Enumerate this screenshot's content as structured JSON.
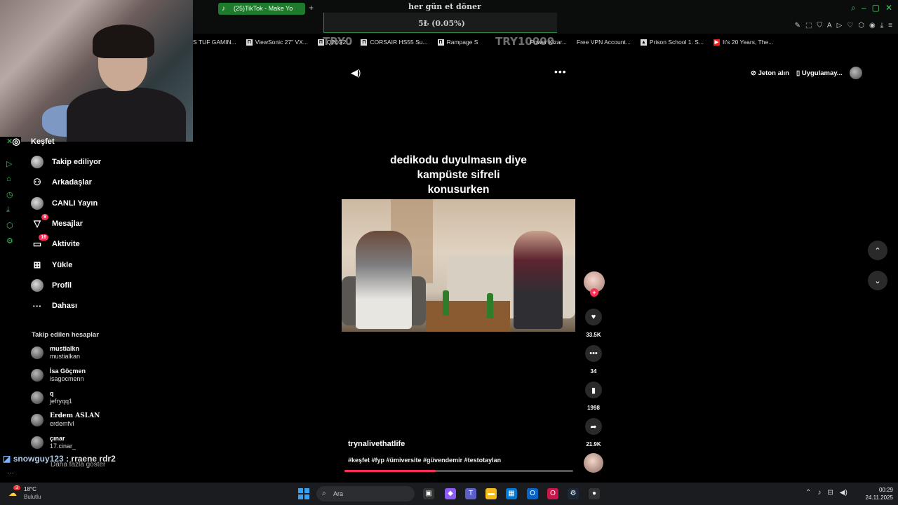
{
  "browser": {
    "tab_label": "(25)TikTok - Make Yo",
    "bookmarks": [
      "S TUF GAMIN...",
      "ViewSonic 27\" VX...",
      "Q24G2...",
      "CORSAIR HS55 Su...",
      "Rampage S",
      "Power Kizar...",
      "Free VPN Account...",
      "Prison School 1. S...",
      "It's 20 Years, The..."
    ]
  },
  "stream_overlay": {
    "title": "her gün et döner",
    "value": "5₺ (0.05%)",
    "left_amount": "TRY0",
    "right_amount": "TRY10000"
  },
  "sidebar": {
    "items": [
      {
        "label": "Keşfet",
        "icon": "compass-icon"
      },
      {
        "label": "Takip ediliyor",
        "icon": "avatar"
      },
      {
        "label": "Arkadaşlar",
        "icon": "friends-icon"
      },
      {
        "label": "CANLI Yayın",
        "icon": "live-icon"
      },
      {
        "label": "Mesajlar",
        "icon": "messages-icon",
        "badge": "9"
      },
      {
        "label": "Aktivite",
        "icon": "activity-icon",
        "badge": "16"
      },
      {
        "label": "Yükle",
        "icon": "upload-icon"
      },
      {
        "label": "Profil",
        "icon": "profile-avatar"
      },
      {
        "label": "Dahası",
        "icon": "more-icon"
      }
    ],
    "following_title": "Takip edilen hesaplar",
    "accounts": [
      {
        "name": "mustialkn",
        "user": "mustialkan"
      },
      {
        "name": "İsa Göçmen",
        "user": "isagocmenn"
      },
      {
        "name": "q",
        "user": "jefryqq1"
      },
      {
        "name": "Erdem ASLAN",
        "user": "erdemfvl"
      },
      {
        "name": "çınar",
        "user": "17.cinar_"
      }
    ],
    "show_more": "Daha fazla göster"
  },
  "chat": {
    "user": "snowguy123",
    "message": ": rraene rdr2"
  },
  "header": {
    "coins": "Jeton alın",
    "app": "Uygulamay..."
  },
  "video": {
    "caption_lines": [
      "dedikodu duyulmasın diye",
      "kampüste sifreli",
      "konusurken"
    ],
    "author": "trynalivethatlife",
    "hashtags": "#keşfet #fyp #ümiversite #güvendemir #testotaylan",
    "progress": 0.4
  },
  "actions": {
    "likes": "33.5K",
    "comments": "34",
    "saves": "1998",
    "shares": "21.9K"
  },
  "taskbar": {
    "badge": "3",
    "temperature": "18°C",
    "weather": "Bulutlu",
    "search_placeholder": "Ara",
    "time": "00:29",
    "date": "24.11.2025"
  },
  "colors": {
    "accent": "#fe2c55",
    "browser_accent": "#3ad05a"
  }
}
